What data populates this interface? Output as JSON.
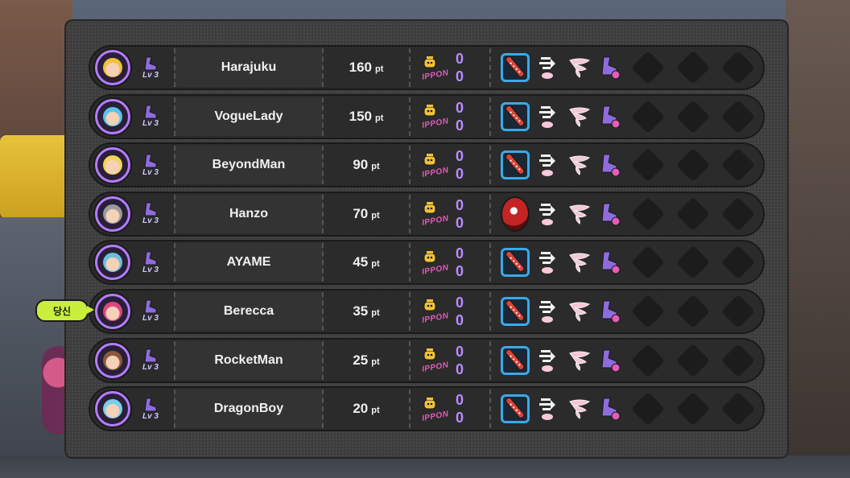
{
  "you_tag": "당신",
  "colors": {
    "avatar_ring": "#b37dff",
    "ippon_count": "#b98dff",
    "ippon_label": "#e35db9",
    "weapon_frame": "#3ba9e8"
  },
  "players": [
    {
      "name": "Harajuku",
      "level": "Lv 3",
      "score": "160",
      "unit": "pt",
      "ippon_top": "0",
      "ippon_bottom": "0",
      "label": "IPPON",
      "weapon": "bat-icon",
      "avatar": "#f0c23a"
    },
    {
      "name": "VogueLady",
      "level": "Lv 3",
      "score": "150",
      "unit": "pt",
      "ippon_top": "0",
      "ippon_bottom": "0",
      "label": "IPPON",
      "weapon": "bat-icon",
      "avatar": "#59c3e8"
    },
    {
      "name": "BeyondMan",
      "level": "Lv 3",
      "score": "90",
      "unit": "pt",
      "ippon_top": "0",
      "ippon_bottom": "0",
      "label": "IPPON",
      "weapon": "bat-icon",
      "avatar": "#f3d35a"
    },
    {
      "name": "Hanzo",
      "level": "Lv 3",
      "score": "70",
      "unit": "pt",
      "ippon_top": "0",
      "ippon_bottom": "0",
      "label": "IPPON",
      "weapon": "ball-icon",
      "avatar": "#9a9a9a"
    },
    {
      "name": "AYAME",
      "level": "Lv 3",
      "score": "45",
      "unit": "pt",
      "ippon_top": "0",
      "ippon_bottom": "0",
      "label": "IPPON",
      "weapon": "bat-icon",
      "avatar": "#6bc0d8"
    },
    {
      "name": "Berecca",
      "level": "Lv 3",
      "score": "35",
      "unit": "pt",
      "ippon_top": "0",
      "ippon_bottom": "0",
      "label": "IPPON",
      "weapon": "bat-icon",
      "avatar": "#d9477e"
    },
    {
      "name": "RocketMan",
      "level": "Lv 3",
      "score": "25",
      "unit": "pt",
      "ippon_top": "0",
      "ippon_bottom": "0",
      "label": "IPPON",
      "weapon": "bat-icon",
      "avatar": "#8a5a3a"
    },
    {
      "name": "DragonBoy",
      "level": "Lv 3",
      "score": "20",
      "unit": "pt",
      "ippon_top": "0",
      "ippon_bottom": "0",
      "label": "IPPON",
      "weapon": "bat-icon",
      "avatar": "#7ad0e8"
    }
  ]
}
